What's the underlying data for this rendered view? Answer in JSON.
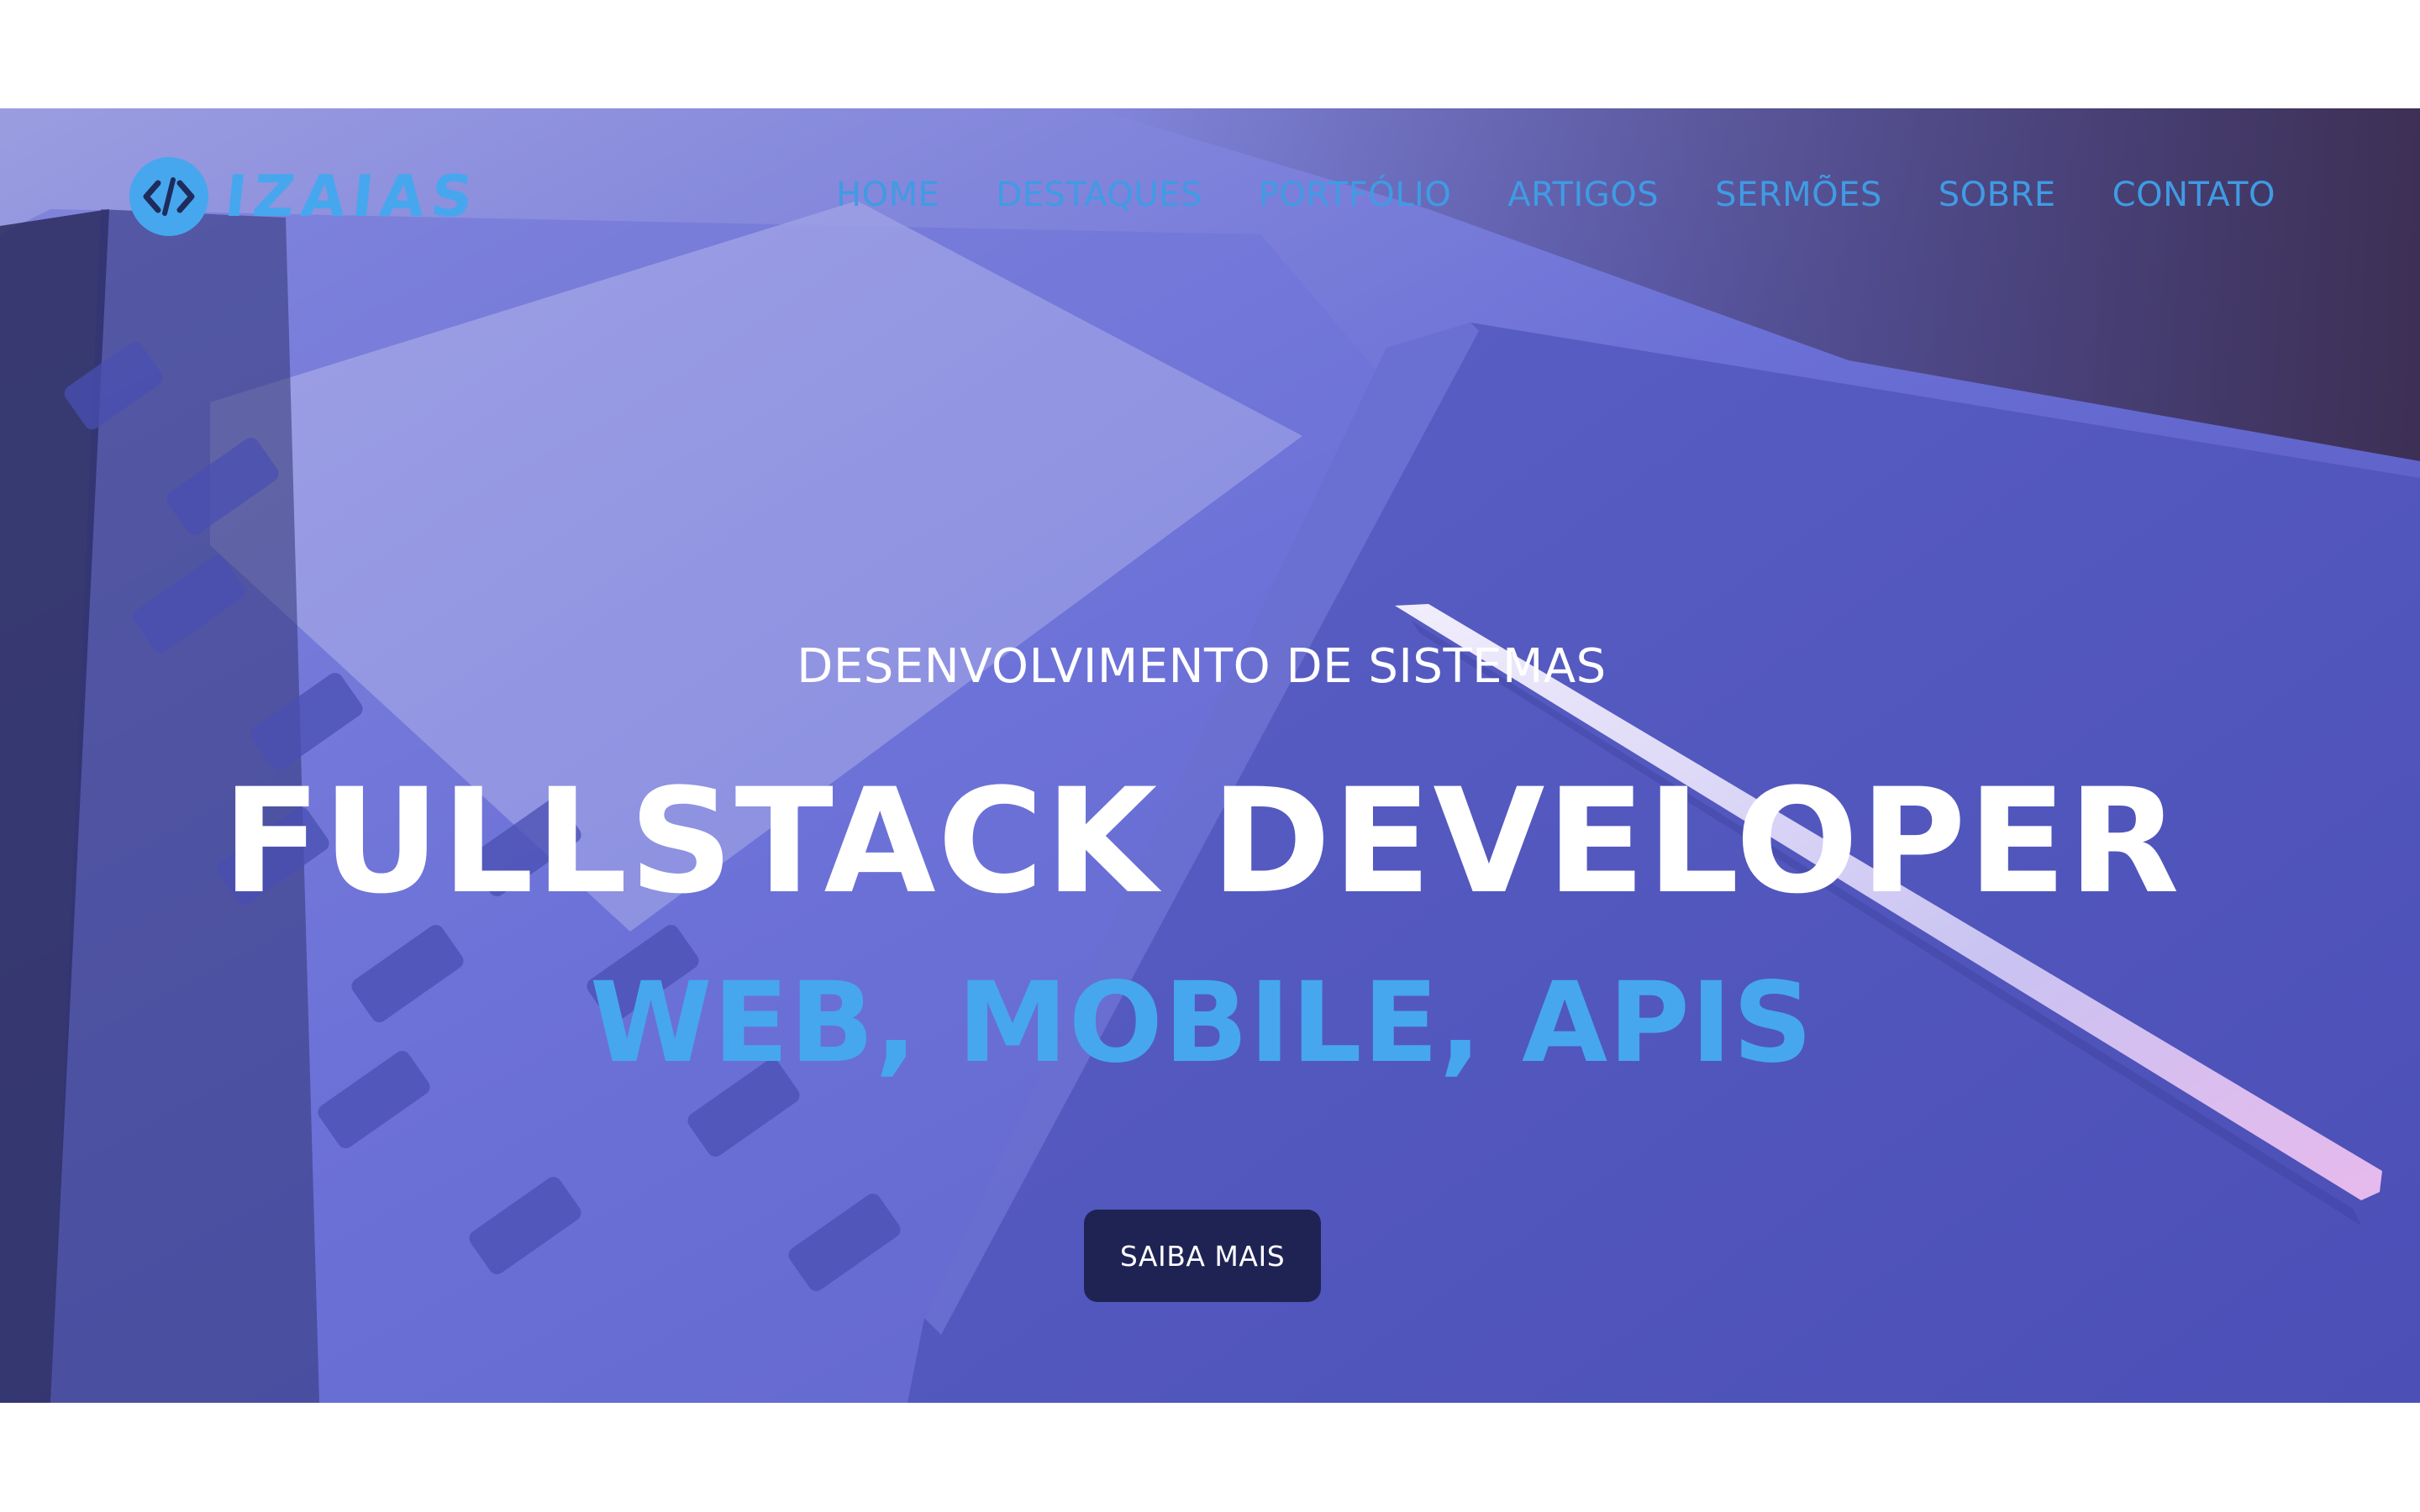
{
  "logo": {
    "symbol": "</>",
    "name": "IZAIAS"
  },
  "nav": {
    "items": [
      "HOME",
      "DESTAQUES",
      "PORTFÓLIO",
      "ARTIGOS",
      "SERMÕES",
      "SOBRE",
      "CONTATO"
    ]
  },
  "hero": {
    "subtitle": "DESENVOLVIMENTO DE SISTEMAS",
    "headline": "FULLSTACK DEVELOPER",
    "tagline": "WEB, MOBILE, APIS",
    "cta_label": "SAIBA MAIS"
  },
  "colors": {
    "accent": "#46a7ee",
    "button": "#1f2354",
    "hero_overlay": "#6f74d6",
    "page_background": "#ffffff"
  },
  "icons": {
    "logo_icon": "code-brackets-icon"
  }
}
